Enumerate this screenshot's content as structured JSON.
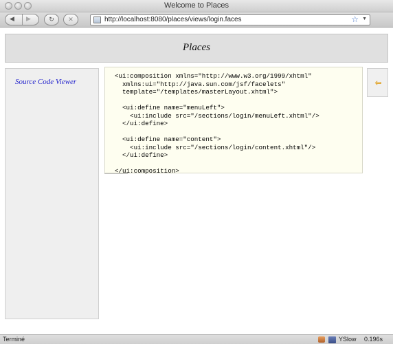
{
  "window": {
    "title": "Welcome to Places"
  },
  "toolbar": {
    "back_glyph": "◀",
    "forward_glyph": "▶",
    "reload_glyph": "↻",
    "stop_glyph": "✕",
    "url": "http://localhost:8080/places/views/login.faces",
    "bookmark_glyph": "☆",
    "dropdown_glyph": "▼"
  },
  "header": {
    "title": "Places"
  },
  "sidebar": {
    "link_label": "Source Code Viewer"
  },
  "source": {
    "code": "<ui:composition xmlns=\"http://www.w3.org/1999/xhtml\"\n  xmlns:ui=\"http://java.sun.com/jsf/facelets\"\n  template=\"/templates/masterLayout.xhtml\">\n\n  <ui:define name=\"menuLeft\">\n    <ui:include src=\"/sections/login/menuLeft.xhtml\"/>\n  </ui:define>\n\n  <ui:define name=\"content\">\n    <ui:include src=\"/sections/login/content.xhtml\"/>\n  </ui:define>\n\n</ui:composition>"
  },
  "back_panel": {
    "glyph": "⇦"
  },
  "status": {
    "text": "Terminé",
    "yslow_label": "YSlow",
    "load_time": "0.196s"
  },
  "colors": {
    "link": "#2222cc",
    "code_background": "#fefef0",
    "back_arrow": "#e0a020"
  }
}
